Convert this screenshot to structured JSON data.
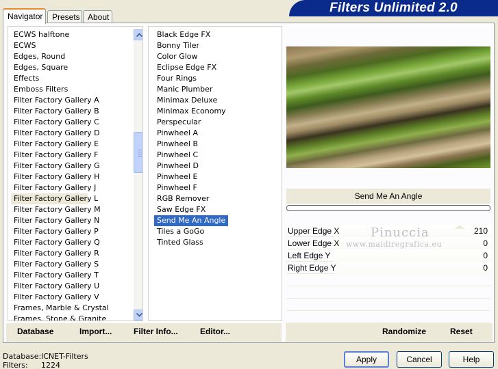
{
  "tabs": [
    "Navigator",
    "Presets",
    "About"
  ],
  "banner_title": "Filters Unlimited 2.0",
  "categories": [
    "ECWS halftone",
    "ECWS",
    "Edges, Round",
    "Edges, Square",
    "Effects",
    "Emboss Filters",
    "Filter Factory Gallery A",
    "Filter Factory Gallery B",
    "Filter Factory Gallery C",
    "Filter Factory Gallery D",
    "Filter Factory Gallery E",
    "Filter Factory Gallery F",
    "Filter Factory Gallery G",
    "Filter Factory Gallery H",
    "Filter Factory Gallery J",
    "Filter Factory Gallery L",
    "Filter Factory Gallery M",
    "Filter Factory Gallery N",
    "Filter Factory Gallery P",
    "Filter Factory Gallery Q",
    "Filter Factory Gallery R",
    "Filter Factory Gallery S",
    "Filter Factory Gallery T",
    "Filter Factory Gallery U",
    "Filter Factory Gallery V",
    "Frames, Marble & Crystal",
    "Frames, Stone & Granite"
  ],
  "selected_category": "Filter Factory Gallery L",
  "filters": [
    "Black Edge FX",
    "Bonny Tiler",
    "Color Glow",
    "Eclipse Edge FX",
    "Four Rings",
    "Manic Plumber",
    "Minimax Deluxe",
    "Minimax Economy",
    "Perspecular",
    "Pinwheel A",
    "Pinwheel B",
    "Pinwheel C",
    "Pinwheel D",
    "Pinwheel E",
    "Pinwheel F",
    "RGB Remover",
    "Saw Edge FX",
    "Send Me An Angle",
    "Tiles a GoGo",
    "Tinted Glass"
  ],
  "selected_filter": "Send Me An Angle",
  "preview": {
    "filter_name": "Send Me An Angle"
  },
  "params": [
    {
      "name": "Upper Edge X",
      "value": "210"
    },
    {
      "name": "Lower Edge X",
      "value": "0"
    },
    {
      "name": "Left Edge Y",
      "value": "0"
    },
    {
      "name": "Right Edge Y",
      "value": "0"
    }
  ],
  "watermark": {
    "line1": "Pinuccia",
    "line2": "www.maidiregrafica.eu"
  },
  "commands": {
    "database": "Database",
    "import": "Import...",
    "filter_info": "Filter Info...",
    "editor": "Editor...",
    "randomize": "Randomize",
    "reset": "Reset"
  },
  "footer": {
    "database_label": "Database:",
    "database_value": "ICNET-Filters",
    "filters_label": "Filters:",
    "filters_value": "1224"
  },
  "buttons": {
    "apply": "Apply",
    "cancel": "Cancel",
    "help": "Help"
  },
  "colors": {
    "banner": "#0a2a8c",
    "selection": "#316ac5",
    "tab_accent": "#e68b2c"
  }
}
